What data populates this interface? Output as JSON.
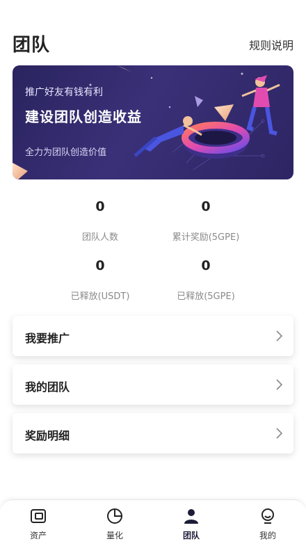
{
  "header": {
    "title": "团队",
    "rules_label": "规则说明"
  },
  "banner": {
    "subtitle": "推广好友有钱有利",
    "headline": "建设团队创造收益",
    "tagline": "全力为团队创造价值"
  },
  "stats": [
    {
      "value": "0",
      "label": "团队人数"
    },
    {
      "value": "0",
      "label": "累计奖励(5GPE)"
    },
    {
      "value": "0",
      "label": "已释放(USDT)"
    },
    {
      "value": "0",
      "label": "已释放(5GPE)"
    }
  ],
  "menu": [
    {
      "label": "我要推广"
    },
    {
      "label": "我的团队"
    },
    {
      "label": "奖励明细"
    }
  ],
  "tabbar": {
    "active": "团队",
    "tabs": [
      {
        "label": "资产",
        "icon": "wallet-icon"
      },
      {
        "label": "量化",
        "icon": "pie-chart-icon"
      },
      {
        "label": "团队",
        "icon": "user-icon"
      },
      {
        "label": "我的",
        "icon": "profile-icon"
      }
    ]
  },
  "colors": {
    "banner_bg": "#2a245f",
    "accent_pink": "#e24bb0",
    "accent_blue": "#4a55e0",
    "active_tab": "#1c1c38"
  }
}
